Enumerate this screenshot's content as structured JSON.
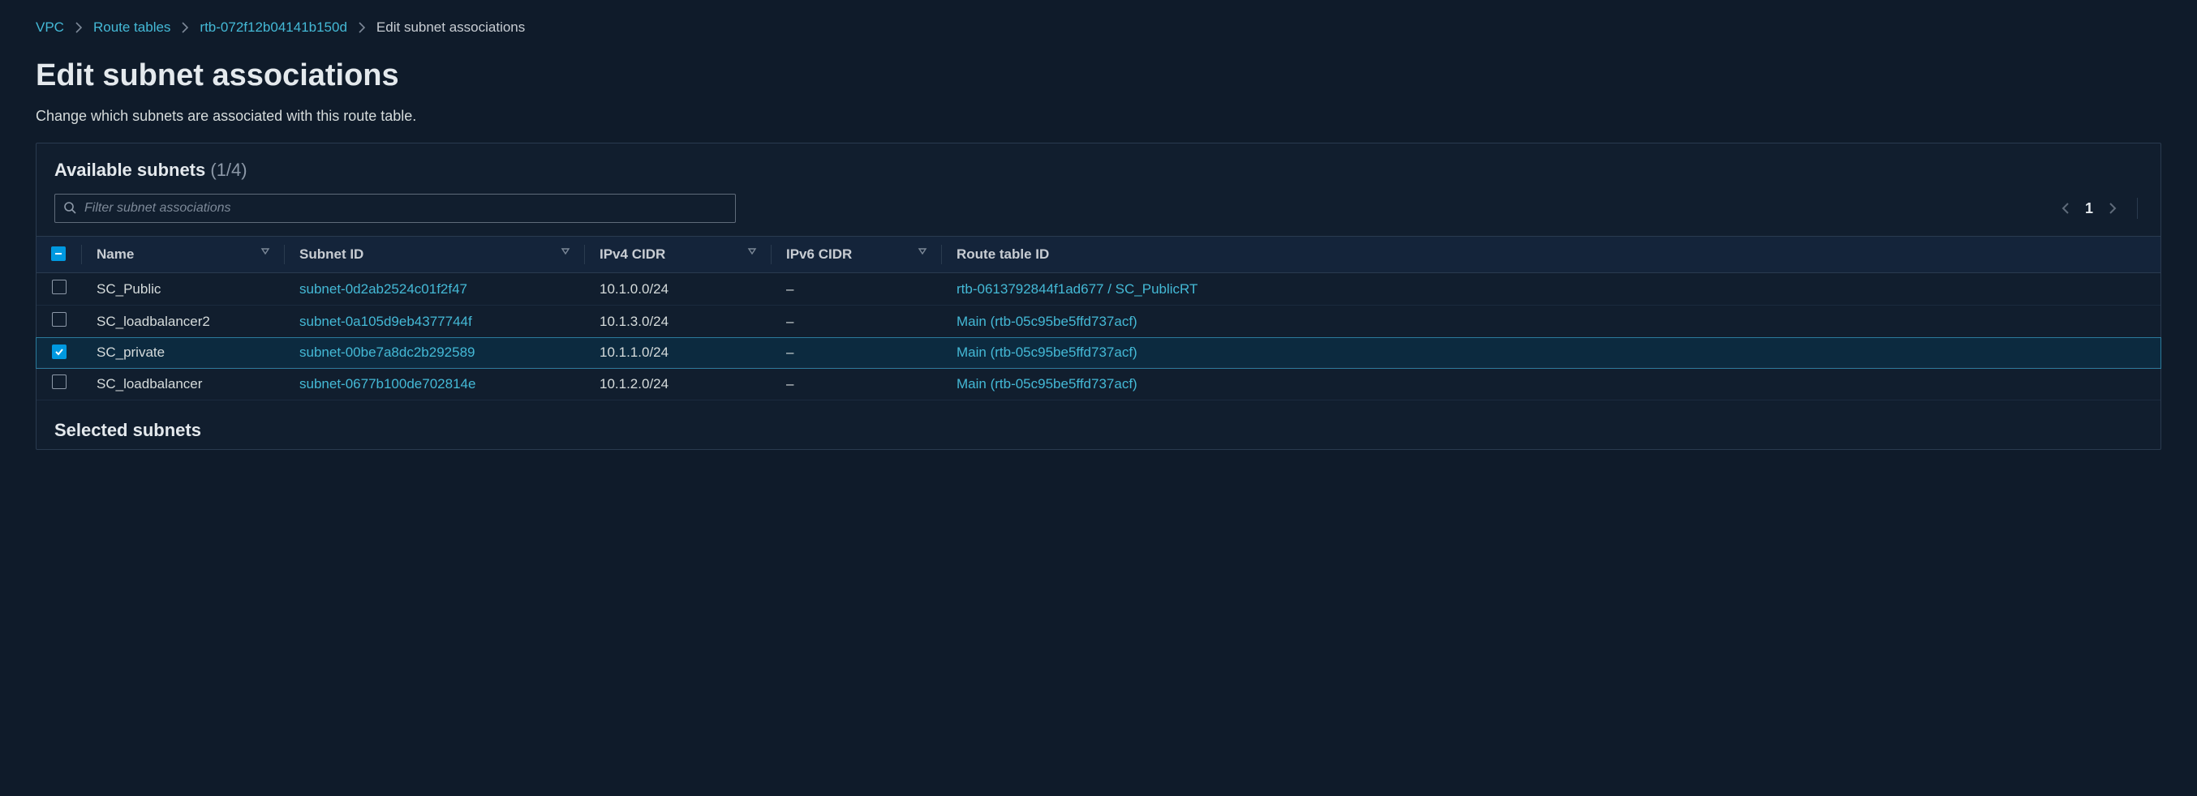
{
  "breadcrumb": {
    "items": [
      {
        "label": "VPC",
        "link": true
      },
      {
        "label": "Route tables",
        "link": true
      },
      {
        "label": "rtb-072f12b04141b150d",
        "link": true
      },
      {
        "label": "Edit subnet associations",
        "link": false
      }
    ]
  },
  "page": {
    "title": "Edit subnet associations",
    "description": "Change which subnets are associated with this route table."
  },
  "available": {
    "title": "Available subnets",
    "count": "(1/4)",
    "filter_placeholder": "Filter subnet associations",
    "columns": {
      "name": "Name",
      "subnet_id": "Subnet ID",
      "ipv4": "IPv4 CIDR",
      "ipv6": "IPv6 CIDR",
      "route_table": "Route table ID"
    },
    "rows": [
      {
        "selected": false,
        "name": "SC_Public",
        "subnet_id": "subnet-0d2ab2524c01f2f47",
        "ipv4": "10.1.0.0/24",
        "ipv6": "–",
        "route_table": "rtb-0613792844f1ad677 / SC_PublicRT"
      },
      {
        "selected": false,
        "name": "SC_loadbalancer2",
        "subnet_id": "subnet-0a105d9eb4377744f",
        "ipv4": "10.1.3.0/24",
        "ipv6": "–",
        "route_table": "Main (rtb-05c95be5ffd737acf)"
      },
      {
        "selected": true,
        "name": "SC_private",
        "subnet_id": "subnet-00be7a8dc2b292589",
        "ipv4": "10.1.1.0/24",
        "ipv6": "–",
        "route_table": "Main (rtb-05c95be5ffd737acf)"
      },
      {
        "selected": false,
        "name": "SC_loadbalancer",
        "subnet_id": "subnet-0677b100de702814e",
        "ipv4": "10.1.2.0/24",
        "ipv6": "–",
        "route_table": "Main (rtb-05c95be5ffd737acf)"
      }
    ]
  },
  "pager": {
    "page": "1"
  },
  "selected_section": {
    "title": "Selected subnets"
  }
}
